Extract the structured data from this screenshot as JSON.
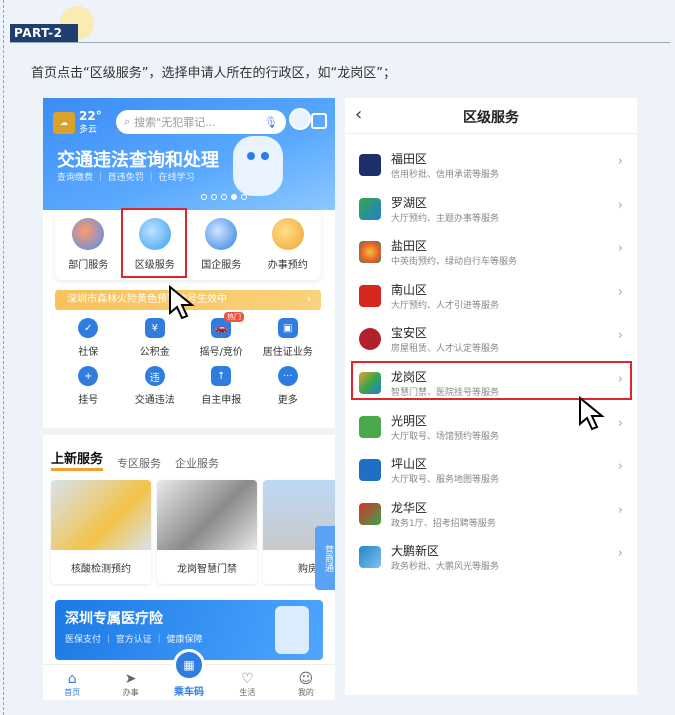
{
  "part_label": "PART-2",
  "instruction": "首页点击“区级服务”，选择申请人所在的行政区，如“龙岗区”；",
  "left_phone": {
    "weather": {
      "temp": "22°",
      "cond": "多云"
    },
    "search_placeholder": "搜索\"无犯罪记...",
    "banner_title": "交通违法查询和处理",
    "banner_subtitle": "查询缴费 ｜ 首违免罚 ｜ 在线学习",
    "quick_items": [
      "部门服务",
      "区级服务",
      "国企服务",
      "办事预约"
    ],
    "notice": "深圳市森林火险黄色预警信号生效中",
    "grid_row1": [
      {
        "label": "社保",
        "icon": "shield-icon",
        "badge": ""
      },
      {
        "label": "公积金",
        "icon": "house-fund-icon",
        "badge": ""
      },
      {
        "label": "摇号/竞价",
        "icon": "car-icon",
        "badge": "热门"
      },
      {
        "label": "居住证业务",
        "icon": "id-card-icon",
        "badge": ""
      }
    ],
    "grid_row2": [
      {
        "label": "挂号",
        "icon": "plus-icon"
      },
      {
        "label": "交通违法",
        "icon": "violation-icon"
      },
      {
        "label": "自主申报",
        "icon": "declare-icon"
      },
      {
        "label": "更多",
        "icon": "more-icon"
      }
    ],
    "tabs": [
      "上新服务",
      "专区服务",
      "企业服务"
    ],
    "cards": [
      "核酸检测预约",
      "龙岗智慧门禁",
      "购房意"
    ],
    "side_tab": "营商通",
    "insurance": {
      "title": "深圳专属医疗险",
      "subtitle": "医保支付 ｜ 官方认证 ｜ 健康保障"
    },
    "nav": [
      "首页",
      "办事",
      "乘车码",
      "生活",
      "我的"
    ]
  },
  "right_phone": {
    "title": "区级服务",
    "districts": [
      {
        "name": "福田区",
        "desc": "信用秒批、信用承诺等服务",
        "color": "#1d2f6b"
      },
      {
        "name": "罗湖区",
        "desc": "大厅预约、主题办事等服务",
        "color": "#3aa54a"
      },
      {
        "name": "盐田区",
        "desc": "中英街预约、绿动自行车等服务",
        "color": "#e85a2a"
      },
      {
        "name": "南山区",
        "desc": "大厅预约、人才引进等服务",
        "color": "#d4281f"
      },
      {
        "name": "宝安区",
        "desc": "房屋租赁、人才认定等服务",
        "color": "#b3202a"
      },
      {
        "name": "龙岗区",
        "desc": "智慧门禁、医院挂号等服务",
        "color": "#e8a32a"
      },
      {
        "name": "光明区",
        "desc": "大厅取号、场馆预约等服务",
        "color": "#48a84a"
      },
      {
        "name": "坪山区",
        "desc": "大厅取号、服务地图等服务",
        "color": "#1f6fc6"
      },
      {
        "name": "龙华区",
        "desc": "政务1厅、招考招聘等服务",
        "color": "#d8312b"
      },
      {
        "name": "大鹏新区",
        "desc": "政务秒批、大鹏风光等服务",
        "color": "#2583c9"
      }
    ]
  }
}
